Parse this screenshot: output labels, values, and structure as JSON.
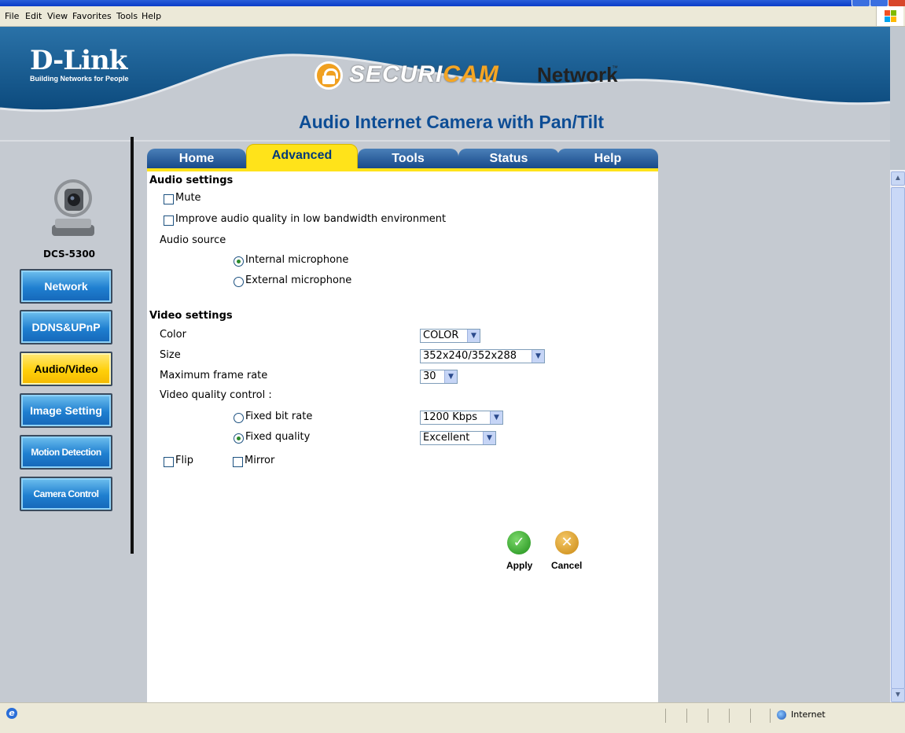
{
  "menubar": {
    "items": [
      "File",
      "Edit",
      "View",
      "Favorites",
      "Tools",
      "Help"
    ]
  },
  "branding": {
    "logo": "D-Link",
    "tagline": "Building Networks for People",
    "brand_part1": "SECURI",
    "brand_part2": "CAM",
    "brand_part3": "Network",
    "trademark": "™",
    "product_title": "Audio Internet Camera with Pan/Tilt"
  },
  "device": {
    "model": "DCS-5300"
  },
  "sidenav": [
    "Network",
    "DDNS&UPnP",
    "Audio/Video",
    "Image Setting",
    "Motion Detection",
    "Camera Control"
  ],
  "tabs": [
    "Home",
    "Advanced",
    "Tools",
    "Status",
    "Help"
  ],
  "audio": {
    "heading": "Audio settings",
    "mute_label": "Mute",
    "improve_label": "Improve audio quality in low bandwidth environment",
    "source_label": "Audio source",
    "internal_label": "Internal microphone",
    "external_label": "External microphone"
  },
  "video": {
    "heading": "Video settings",
    "color_label": "Color",
    "color_value": "COLOR",
    "size_label": "Size",
    "size_value": "352x240/352x288",
    "framerate_label": "Maximum frame rate",
    "framerate_value": "30",
    "quality_label": "Video quality control :",
    "fixed_bitrate_label": "Fixed bit rate",
    "bitrate_value": "1200 Kbps",
    "fixed_quality_label": "Fixed quality",
    "quality_value": "Excellent",
    "flip_label": "Flip",
    "mirror_label": "Mirror"
  },
  "actions": {
    "apply": "Apply",
    "cancel": "Cancel"
  },
  "statusbar": {
    "zone": "Internet"
  },
  "colors": {
    "tab_active": "#ffe31a",
    "tab": "#184a8a",
    "banner": "#1e5d8c",
    "title": "#0d4d95"
  }
}
